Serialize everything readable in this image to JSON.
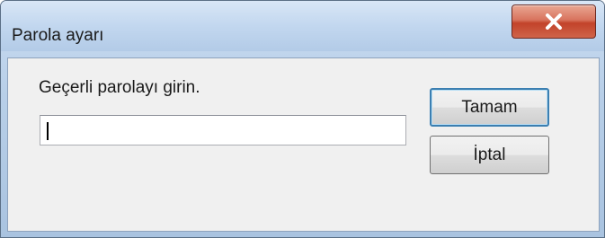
{
  "window": {
    "title": "Parola ayarı",
    "close_label": "X"
  },
  "dialog": {
    "prompt": "Geçerli parolayı girin.",
    "password_value": "",
    "ok_label": "Tamam",
    "cancel_label": "İptal"
  },
  "colors": {
    "titlebar": "#c2d7ef",
    "close_button": "#c2432a",
    "client_bg": "#f0f0f0",
    "default_button_border": "#3c7fb1"
  }
}
